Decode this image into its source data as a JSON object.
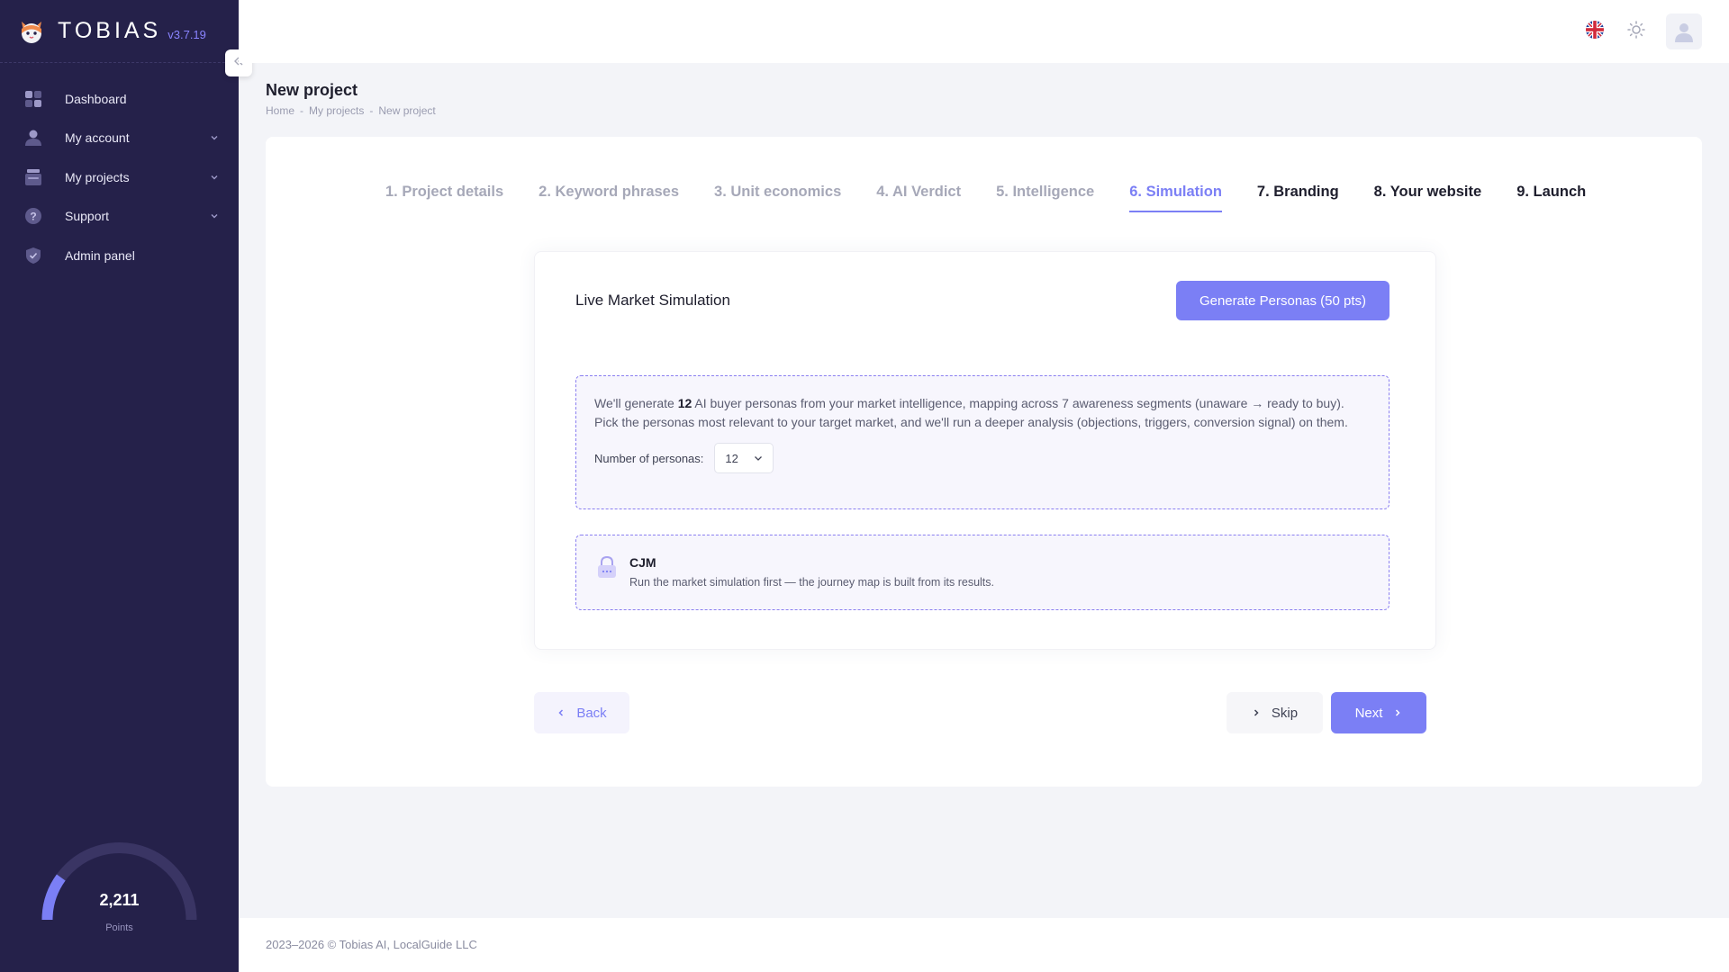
{
  "app": {
    "name": "TOBIAS",
    "version": "v3.7.19",
    "logo_icon": "cat-logo-icon",
    "accent_color": "#7b7ff5",
    "sidebar_color": "#25214a"
  },
  "sidebar": {
    "items": [
      {
        "label": "Dashboard",
        "icon": "dashboard-icon",
        "expandable": false
      },
      {
        "label": "My account",
        "icon": "user-icon",
        "expandable": true
      },
      {
        "label": "My projects",
        "icon": "projects-icon",
        "expandable": true
      },
      {
        "label": "Support",
        "icon": "question-icon",
        "expandable": true
      },
      {
        "label": "Admin panel",
        "icon": "shield-check-icon",
        "expandable": false
      }
    ],
    "points": {
      "value": "2,211",
      "label": "Points",
      "gauge_fraction": 0.2
    }
  },
  "header": {
    "icons": [
      "uk-flag-icon",
      "sun-icon",
      "user-avatar-icon"
    ]
  },
  "page": {
    "title": "New project",
    "breadcrumb": [
      "Home",
      "My projects",
      "New project"
    ],
    "breadcrumb_separator": "-"
  },
  "steps": [
    {
      "label": "1. Project details",
      "state": "done"
    },
    {
      "label": "2. Keyword phrases",
      "state": "done"
    },
    {
      "label": "3. Unit economics",
      "state": "done"
    },
    {
      "label": "4. AI Verdict",
      "state": "done"
    },
    {
      "label": "5. Intelligence",
      "state": "done"
    },
    {
      "label": "6. Simulation",
      "state": "active"
    },
    {
      "label": "7. Branding",
      "state": "todo"
    },
    {
      "label": "8. Your website",
      "state": "todo"
    },
    {
      "label": "9. Launch",
      "state": "todo"
    }
  ],
  "simulation": {
    "title": "Live Market Simulation",
    "generate_button": "Generate Personas (50 pts)",
    "info": {
      "text_before": "We'll generate ",
      "count": "12",
      "text_after": " AI buyer personas from your market intelligence, mapping across 7 awareness segments (unaware → ready to buy). Pick the personas most relevant to your target market, and we'll run a deeper analysis (objections, triggers, conversion signal) on them.",
      "persona_label": "Number of personas:",
      "persona_value": "12"
    },
    "cjm": {
      "title": "CJM",
      "description": "Run the market simulation first — the journey map is built from its results.",
      "icon": "lock-icon"
    }
  },
  "nav": {
    "back": "Back",
    "skip": "Skip",
    "next": "Next"
  },
  "footer": {
    "text": "2023–2026 © Tobias AI, LocalGuide LLC"
  }
}
